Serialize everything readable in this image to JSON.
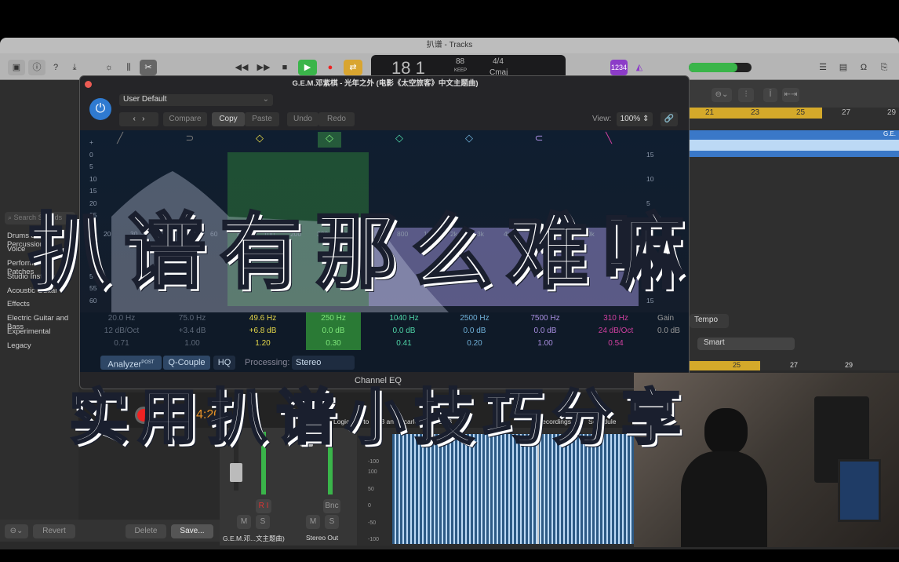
{
  "window": {
    "title": "扒谱 - Tracks"
  },
  "transport": {
    "position": "18 1",
    "tempo": "88",
    "tempo_label": "KEEP",
    "signature": "4/4",
    "key": "Cmaj",
    "count_in": "1234"
  },
  "library": {
    "search_placeholder": "Search Sounds",
    "items": [
      "Drums and Percussion",
      "Voice",
      "Performance Patches",
      "Studio Instruments",
      "Acoustic Guitar",
      "Effects",
      "Electric Guitar and Bass",
      "Experimental",
      "Legacy"
    ],
    "revert": "Revert",
    "delete": "Delete",
    "save": "Save..."
  },
  "eq": {
    "title": "G.E.M.邓紫棋 - 光年之外 (电影《太空旅客》中文主题曲)",
    "preset": "User Default",
    "compare": "Compare",
    "copy": "Copy",
    "paste": "Paste",
    "undo": "Undo",
    "redo": "Redo",
    "view_label": "View:",
    "view_value": "100%",
    "left_scale": [
      "+",
      "0",
      "5",
      "10",
      "15",
      "20",
      "25",
      "30",
      "35",
      "40",
      "45",
      "50",
      "55",
      "60"
    ],
    "right_scale": [
      "15",
      "10",
      "5",
      "0",
      "5",
      "10",
      "15"
    ],
    "freq_labels": [
      "20",
      "30",
      "40",
      "50",
      "60",
      "80",
      "100",
      "200",
      "300",
      "400",
      "600",
      "800",
      "1k",
      "2k",
      "3k",
      "4k",
      "6k",
      "8k",
      "10k"
    ],
    "bands": [
      {
        "freq": "20.0 Hz",
        "gain": "12 dB/Oct",
        "q": "0.71",
        "color": "#777777"
      },
      {
        "freq": "75.0 Hz",
        "gain": "+3.4 dB",
        "q": "1.00",
        "color": "#777777"
      },
      {
        "freq": "49.6 Hz",
        "gain": "+6.8 dB",
        "q": "1.20",
        "color": "#e5d84a"
      },
      {
        "freq": "250 Hz",
        "gain": "0.0 dB",
        "q": "0.30",
        "color": "#7ee87a"
      },
      {
        "freq": "1040 Hz",
        "gain": "0.0 dB",
        "q": "0.41",
        "color": "#4fd6a8"
      },
      {
        "freq": "2500 Hz",
        "gain": "0.0 dB",
        "q": "0.20",
        "color": "#6fb0d8"
      },
      {
        "freq": "7500 Hz",
        "gain": "0.0 dB",
        "q": "1.00",
        "color": "#a88ee0"
      },
      {
        "freq": "310 Hz",
        "gain": "24 dB/Oct",
        "q": "0.54",
        "color": "#d040a0"
      }
    ],
    "gain_label": "Gain",
    "gain_value": "0.0 dB",
    "analyzer": "Analyzer",
    "analyzer_sup": "POST",
    "qcouple": "Q-Couple",
    "hq": "HQ",
    "processing_label": "Processing:",
    "processing_value": "Stereo",
    "plugin_name": "Channel EQ"
  },
  "tracks": {
    "ruler": [
      "21",
      "23",
      "25",
      "27",
      "29"
    ],
    "region": "G.E.",
    "tempo": "Tempo",
    "mode_value": "Smart",
    "ruler2": [
      "25",
      "27",
      "29"
    ]
  },
  "control_bar": {
    "device": "Logic Pro to MP3 and Scarlett 18i8 USB",
    "recordings": "Recordings",
    "schedule": "Schedule",
    "time": "4:20"
  },
  "mixer": {
    "channel1": "G.E.M.邓...文主题曲)",
    "channel2": "Stereo Out",
    "m": "M",
    "s": "S",
    "bnc": "Bnc",
    "ri": "R I"
  },
  "wave_scale": [
    "-50",
    "-100",
    "100",
    "50",
    "0",
    "-50",
    "-100"
  ],
  "overlay": {
    "headline": "扒谱有那么难嘛",
    "subtitle": "实用扒谱小技巧分享"
  }
}
